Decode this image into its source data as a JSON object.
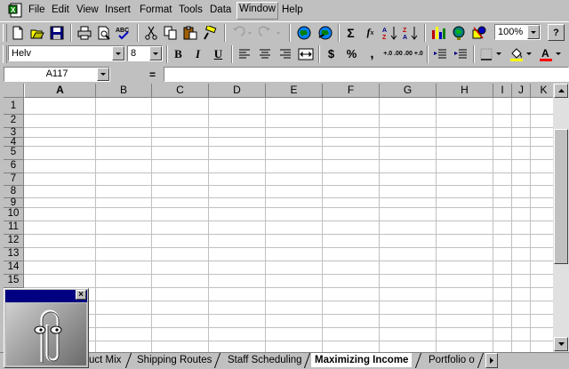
{
  "menubar": {
    "items": [
      "File",
      "Edit",
      "View",
      "Insert",
      "Format",
      "Tools",
      "Data",
      "Window",
      "Help"
    ],
    "active": "Window"
  },
  "toolbar_standard": {
    "zoom": "100%",
    "icons": [
      "new-icon",
      "open-icon",
      "save-icon",
      "print-icon",
      "print-preview-icon",
      "spelling-icon",
      "cut-icon",
      "copy-icon",
      "paste-icon",
      "format-painter-icon",
      "undo-icon",
      "redo-icon",
      "web-icon",
      "web-toolbar-icon",
      "autosum-icon",
      "function-icon",
      "sort-ascending-icon",
      "sort-descending-icon",
      "chart-wizard-icon",
      "map-icon",
      "drawing-icon",
      "help-icon"
    ]
  },
  "toolbar_formatting": {
    "font": "Helv",
    "size": "8",
    "bold": "B",
    "italic": "I",
    "underline": "U",
    "currency": "$",
    "percent": "%",
    "comma": ",",
    "increase_decimal": "+.0 .00",
    "decrease_decimal": ".00 +.0"
  },
  "formula_bar": {
    "name_box": "A117",
    "equals": "=",
    "content": ""
  },
  "columns": [
    "A",
    "B",
    "C",
    "D",
    "E",
    "F",
    "G",
    "H",
    "I",
    "J",
    "K"
  ],
  "selected_column": "A",
  "rows": [
    "1",
    "2",
    "3",
    "4",
    "5",
    "6",
    "7",
    "8",
    "9",
    "10",
    "11",
    "12",
    "13",
    "14",
    "15"
  ],
  "sheet_tabs": {
    "items": [
      "uct Mix",
      "Shipping Routes",
      "Staff Scheduling",
      "Maximizing Income",
      "Portfolio o"
    ],
    "active": "Maximizing Income"
  },
  "colors": {
    "face": "#c0c0c0",
    "titlebar": "#000080",
    "grid": "#c0c0c0"
  },
  "office_assistant": {
    "icon": "paperclip-icon"
  }
}
